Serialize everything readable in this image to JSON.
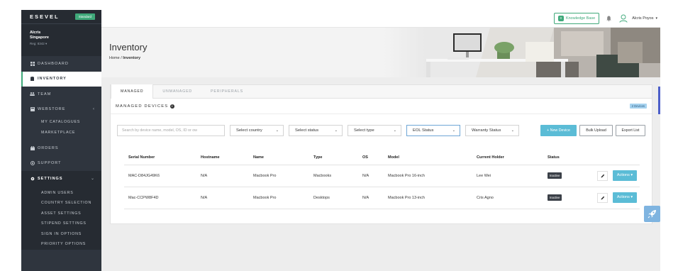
{
  "sidebar": {
    "brand": "ESEVEL",
    "plan_badge": "Standard",
    "user": {
      "name": "Alcris",
      "location": "Singapore",
      "reg": "Reg: 8342"
    },
    "items": [
      {
        "label": "DASHBOARD",
        "icon": "grid-icon"
      },
      {
        "label": "INVENTORY",
        "icon": "clipboard-icon"
      },
      {
        "label": "TEAM",
        "icon": "users-icon"
      },
      {
        "label": "WEBSTORE",
        "icon": "store-icon"
      },
      {
        "label": "ORDERS",
        "icon": "bag-icon"
      },
      {
        "label": "SUPPORT",
        "icon": "support-icon"
      },
      {
        "label": "SETTINGS",
        "icon": "gear-icon"
      }
    ],
    "webstore_sub": [
      "MY CATALOGUES",
      "MARKETPLACE"
    ],
    "settings_sub": [
      "ADMIN USERS",
      "COUNTRY SELECTION",
      "ASSET SETTINGS",
      "STIPEND SETTINGS",
      "SIGN IN OPTIONS",
      "PRIORITY OPTIONS"
    ]
  },
  "topbar": {
    "knowledge_base": "Knowledge Base",
    "user_name": "Alcris Poyos"
  },
  "header": {
    "title": "Inventory",
    "breadcrumb_home": "Home",
    "breadcrumb_sep": "/",
    "breadcrumb_current": "Inventory"
  },
  "tabs": [
    "MANAGED",
    "UNMANAGED",
    "PERIPHERALS"
  ],
  "section": {
    "title": "MANAGED DEVICES",
    "count": "2 Devices"
  },
  "filters": {
    "search_placeholder": "Search by device name, model, OS, ID or ow",
    "country": "Select country",
    "status": "Select status",
    "type": "Select type",
    "eol": "EOL Status",
    "warranty": "Warranty Status"
  },
  "buttons": {
    "new_device": "+ New Device",
    "bulk_upload": "Bulk Upload",
    "export": "Export List",
    "actions": "Actions"
  },
  "table": {
    "columns": [
      "Serial Number",
      "Hostname",
      "Name",
      "Type",
      "OS",
      "Model",
      "Current Holder",
      "Status"
    ],
    "rows": [
      {
        "serial": "MAC-D84JG49K6",
        "hostname": "N/A",
        "name": "Macbook Pro",
        "type": "Macbooks",
        "os": "N/A",
        "model": "Macbook Pro 16-inch",
        "holder": "Lee Wei",
        "status": "Inactive"
      },
      {
        "serial": "Mac-CCPW8F4D",
        "hostname": "N/A",
        "name": "Macbook Pro",
        "type": "Desktops",
        "os": "N/A",
        "model": "Macbook Pro 13-inch",
        "holder": "Cris Agno",
        "status": "Inactive"
      }
    ]
  },
  "colors": {
    "sidebar_bg": "#2f353e",
    "accent_green": "#3fa97a",
    "accent_blue": "#5bbcd6"
  }
}
